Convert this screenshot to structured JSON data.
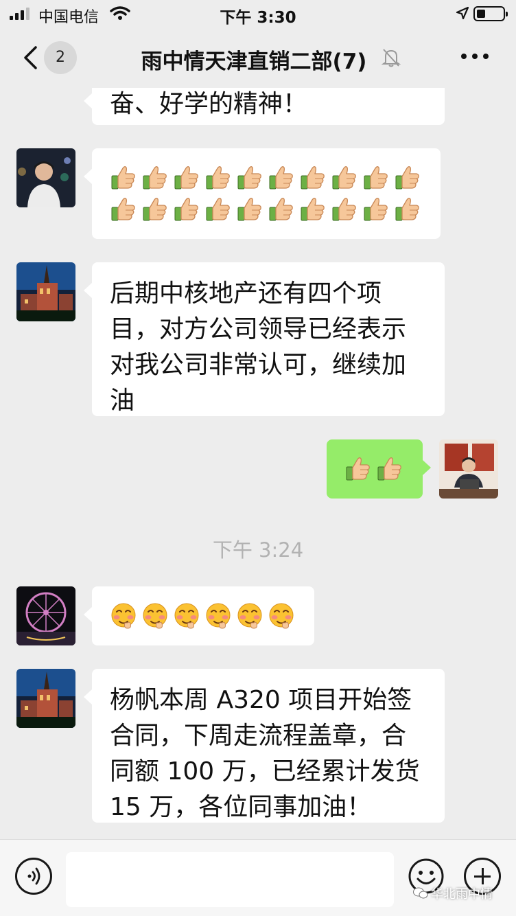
{
  "status_bar": {
    "carrier": "中国电信",
    "time": "下午 3:30"
  },
  "header": {
    "title": "雨中情天津直销二部(7)",
    "unread_count": "2"
  },
  "messages": [
    {
      "side": "in",
      "text": "奋、好学的精神！"
    },
    {
      "side": "in",
      "emoji": "thumbs-up",
      "count": 20
    },
    {
      "side": "in",
      "lines": [
        "后期中核地产还有四个项",
        "目，对方公司领导已经表示",
        "对我公司非常认可，继续加",
        "油"
      ]
    },
    {
      "side": "out",
      "emoji": "thumbs-up",
      "count": 2
    },
    {
      "time_divider": "下午 3:24"
    },
    {
      "side": "in",
      "emoji": "blushing-face",
      "count": 6
    },
    {
      "side": "in",
      "lines": [
        "杨帆本周 A320 项目开始签",
        "合同，下周走流程盖章，合",
        "同额 100 万，已经累计发货",
        "15 万，各位同事加油！"
      ]
    }
  ],
  "watermark": "华北雨中情",
  "colors": {
    "background": "#ededed",
    "bubble_in": "#ffffff",
    "bubble_out": "#95ec69",
    "time_text": "#b2b2b2"
  }
}
